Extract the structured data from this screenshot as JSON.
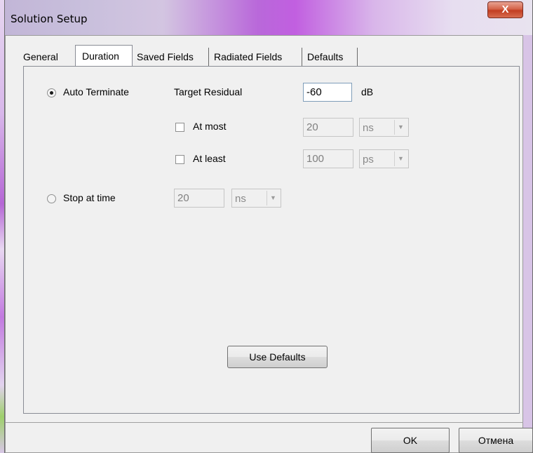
{
  "window": {
    "title": "Solution Setup",
    "close_glyph": "X"
  },
  "tabs": [
    {
      "label": "General",
      "active": false
    },
    {
      "label": "Duration",
      "active": true
    },
    {
      "label": "Saved Fields",
      "active": false
    },
    {
      "label": "Radiated Fields",
      "active": false
    },
    {
      "label": "Defaults",
      "active": false
    }
  ],
  "auto_terminate": {
    "label": "Auto Terminate",
    "selected": true,
    "target_residual_label": "Target Residual",
    "target_residual_value": "-60",
    "target_residual_unit": "dB",
    "at_most": {
      "label": "At most",
      "checked": false,
      "value": "20",
      "unit": "ns"
    },
    "at_least": {
      "label": "At least",
      "checked": false,
      "value": "100",
      "unit": "ps"
    }
  },
  "stop_at_time": {
    "label": "Stop at time",
    "selected": false,
    "value": "20",
    "unit": "ns"
  },
  "buttons": {
    "use_defaults": "Use Defaults",
    "ok": "OK",
    "cancel": "Отмена"
  },
  "icons": {
    "dropdown": "chevron-down-icon",
    "close": "close-icon"
  }
}
